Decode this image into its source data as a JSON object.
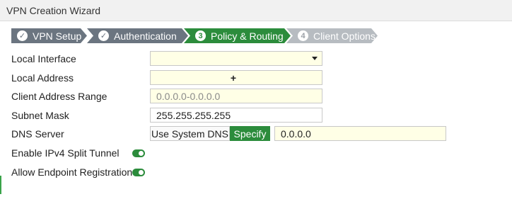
{
  "window": {
    "title": "VPN Creation Wizard"
  },
  "steps": [
    {
      "label": "VPN Setup",
      "state": "done",
      "icon": "check-icon",
      "glyph": "✓"
    },
    {
      "label": "Authentication",
      "state": "done",
      "icon": "check-icon",
      "glyph": "✓"
    },
    {
      "label": "Policy & Routing",
      "state": "active",
      "icon": "step-number-icon",
      "glyph": "3"
    },
    {
      "label": "Client Options",
      "state": "pending",
      "icon": "step-number-icon",
      "glyph": "4"
    }
  ],
  "form": {
    "local_interface": {
      "label": "Local Interface",
      "value": ""
    },
    "local_address": {
      "label": "Local Address",
      "add_glyph": "+"
    },
    "client_address_range": {
      "label": "Client Address Range",
      "placeholder": "0.0.0.0-0.0.0.0"
    },
    "subnet_mask": {
      "label": "Subnet Mask",
      "value": "255.255.255.255"
    },
    "dns_server": {
      "label": "DNS Server",
      "options": [
        "Use System DNS",
        "Specify"
      ],
      "selected": "Specify",
      "value": "0.0.0.0"
    },
    "split_tunnel": {
      "label": "Enable IPv4 Split Tunnel",
      "enabled": true
    },
    "endpoint_registration": {
      "label": "Allow Endpoint Registration",
      "enabled": true
    }
  },
  "colors": {
    "accent": "#2c8c3c",
    "step_done": "#6b7580",
    "step_pending": "#b7bcc1",
    "field_bg": "#ffffe6"
  }
}
